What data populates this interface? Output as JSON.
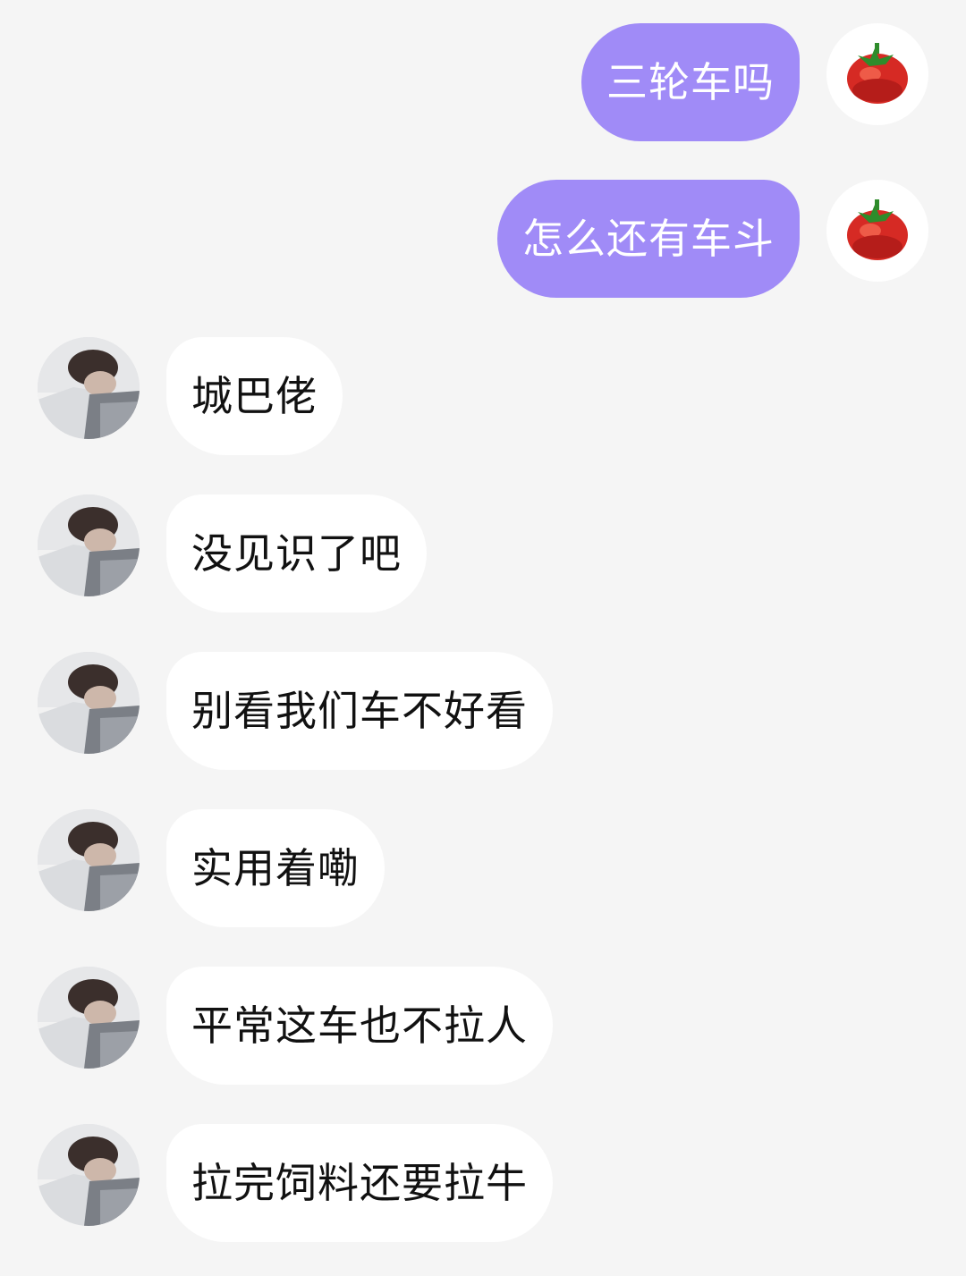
{
  "colors": {
    "background": "#f5f5f5",
    "self_bubble": "#a08bf7",
    "self_text": "#ffffff",
    "other_bubble": "#ffffff",
    "other_text": "#111111"
  },
  "participants": {
    "self": {
      "avatar_icon": "tomato-icon"
    },
    "other": {
      "avatar_icon": "profile-photo"
    }
  },
  "messages": [
    {
      "sender": "self",
      "text": "三轮车吗"
    },
    {
      "sender": "self",
      "text": "怎么还有车斗"
    },
    {
      "sender": "other",
      "text": "城巴佬"
    },
    {
      "sender": "other",
      "text": "没见识了吧"
    },
    {
      "sender": "other",
      "text": "别看我们车不好看"
    },
    {
      "sender": "other",
      "text": "实用着嘞"
    },
    {
      "sender": "other",
      "text": "平常这车也不拉人"
    },
    {
      "sender": "other",
      "text": "拉完饲料还要拉牛"
    }
  ]
}
